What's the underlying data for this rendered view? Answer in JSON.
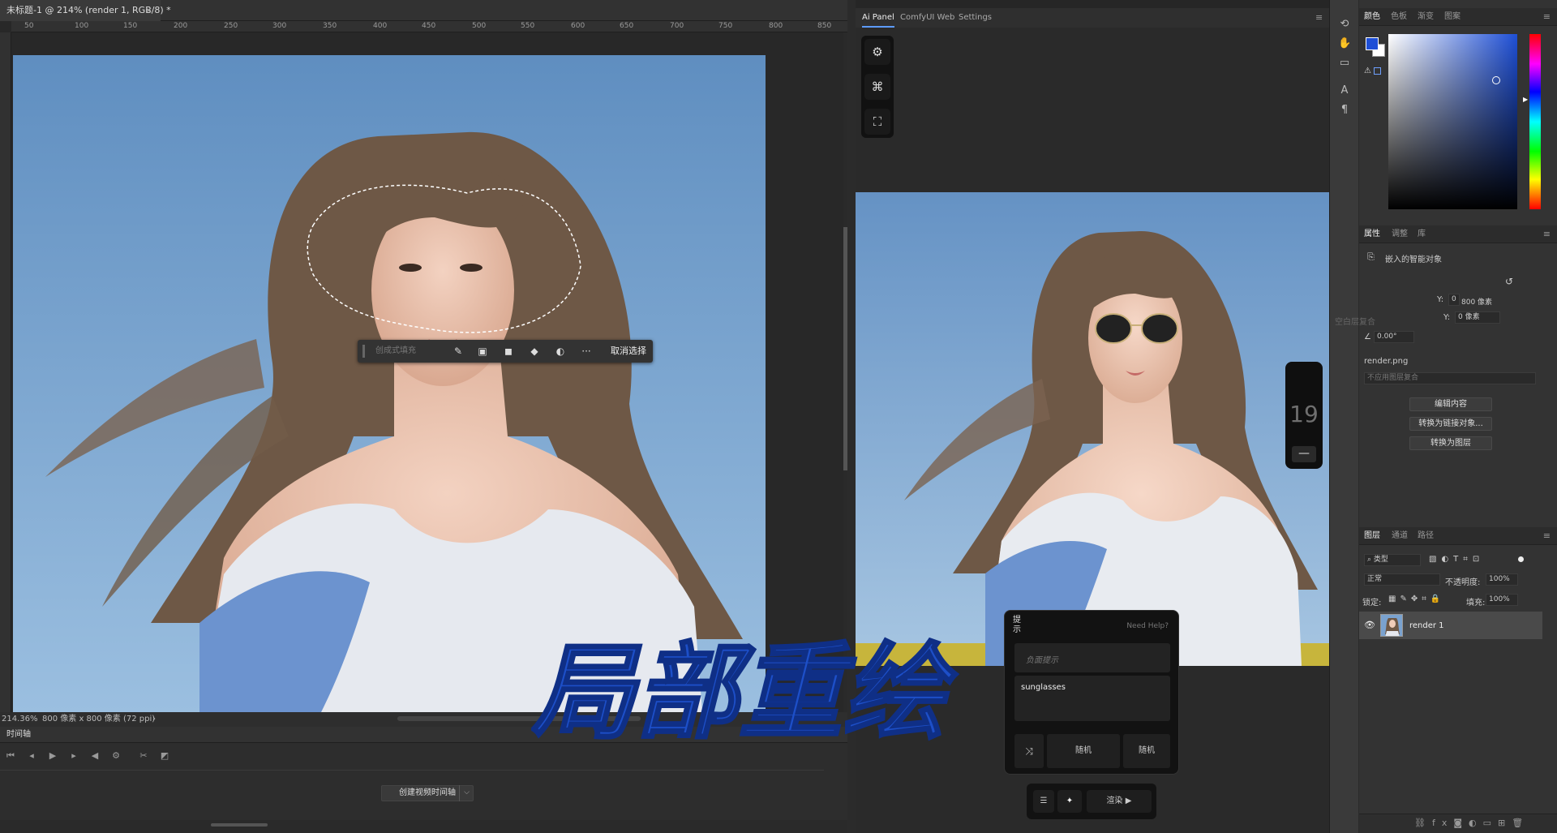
{
  "document": {
    "tab_title": "未标题-1 @ 214% (render 1, RGB/8) *",
    "tab_close": "×",
    "ruler_ticks": [
      "50",
      "100",
      "150",
      "200",
      "250",
      "300",
      "350",
      "400",
      "450",
      "500",
      "550",
      "600",
      "650",
      "700",
      "750",
      "800",
      "850"
    ],
    "status_zoom": "214.36%",
    "status_info": "800 像素 x 800 像素 (72 ppi)",
    "status_arrow": "›"
  },
  "context_bar": {
    "generative_fill": "创成式填充",
    "deselect": "取消选择",
    "more": "···"
  },
  "timeline": {
    "title": "时间轴",
    "create_button": "创建视频时间轴",
    "dropdown": "⌵"
  },
  "overlay": {
    "title": "局部重绘",
    "color": "#1d4fc8"
  },
  "ai_panel": {
    "tabs": [
      "Ai Panel",
      "ComfyUI Web",
      "Settings"
    ],
    "menu": "≡",
    "tool_icons": [
      "gear-icon",
      "hierarchy-icon",
      "fullscreen-icon"
    ],
    "zoom_value": "19",
    "zoom_minus": "—",
    "prompt": {
      "title": "提示",
      "help": "Need Help?",
      "negative_placeholder": "负面提示",
      "positive_value": "sunglasses",
      "random_1": "随机",
      "random_2": "随机"
    },
    "render_label": "渲染"
  },
  "color_panel": {
    "tabs": [
      "颜色",
      "色板",
      "渐变",
      "图案"
    ],
    "foreground": "#1e4fd6",
    "background": "#ffffff"
  },
  "properties_panel": {
    "tabs": [
      "属性",
      "调整",
      "库"
    ],
    "object_type": "嵌入的智能对象",
    "y_label_1": "Y:",
    "y_value_1": "0",
    "y_unit_1": "800 像素",
    "y_label_2": "Y:",
    "y_value_2": "0 像素",
    "blend_faded": "空白层复合",
    "angle": "0.00°",
    "file_name": "render.png",
    "layer_comp": "不应用图层复合",
    "btn_edit": "编辑内容",
    "btn_convert_linked": "转换为链接对象...",
    "btn_convert_layer": "转换为图层"
  },
  "layers_panel": {
    "tabs": [
      "图层",
      "通道",
      "路径"
    ],
    "filter_kind": "类型",
    "blend_mode": "正常",
    "opacity_label": "不透明度:",
    "opacity_value": "100%",
    "lock_label": "锁定:",
    "fill_label": "填充:",
    "fill_value": "100%",
    "layer_name": "render 1"
  }
}
